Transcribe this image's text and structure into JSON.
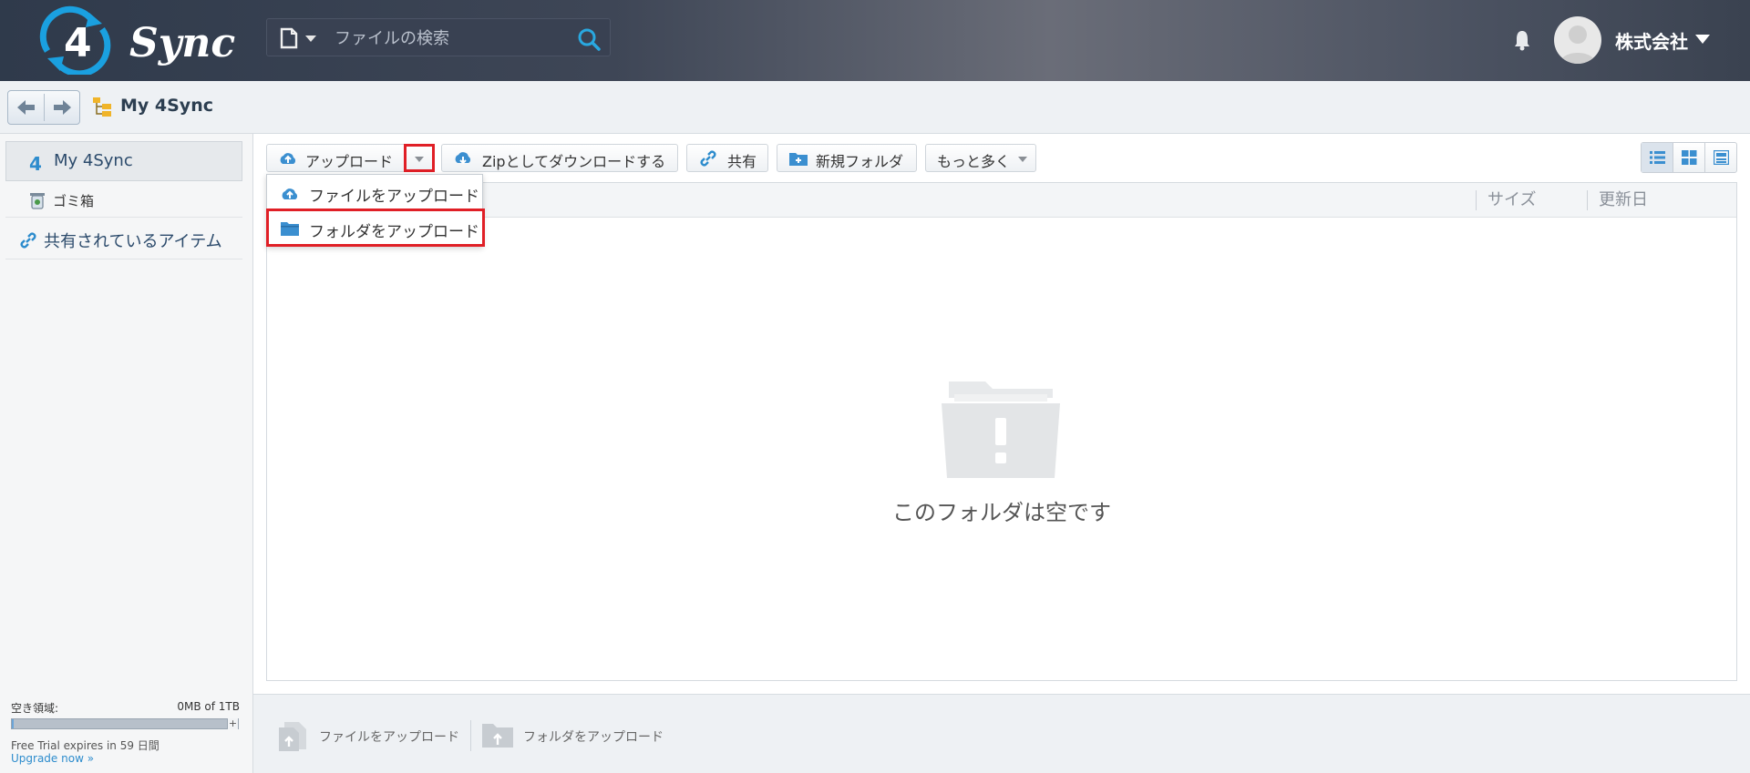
{
  "header": {
    "logo_text": "Sync",
    "logo_digit": "4",
    "search_placeholder": "ファイルの検索",
    "user_name": "株式会社"
  },
  "breadcrumb": {
    "current": "My 4Sync"
  },
  "sidebar": {
    "items": [
      {
        "label": "My 4Sync",
        "icon": "4sync-icon",
        "active": true
      },
      {
        "label": "ゴミ箱",
        "icon": "trash-icon"
      },
      {
        "label": "共有されているアイテム",
        "icon": "link-icon"
      }
    ],
    "storage": {
      "label": "空き領域:",
      "value": "0MB of 1TB",
      "fraction": 0.0,
      "trial": "Free Trial expires in 59 日間",
      "upgrade": "Upgrade now »"
    }
  },
  "toolbar": {
    "upload": "アップロード",
    "zip_download": "Zipとしてダウンロードする",
    "share": "共有",
    "new_folder": "新規フォルダ",
    "more": "もっと多く"
  },
  "upload_menu": {
    "items": [
      {
        "label": "ファイルをアップロード",
        "icon": "cloud-upload-icon"
      },
      {
        "label": "フォルダをアップロード",
        "icon": "folder-icon",
        "highlighted": true
      }
    ]
  },
  "file_list": {
    "columns": {
      "size": "サイズ",
      "date": "更新日"
    },
    "empty_message": "このフォルダは空です"
  },
  "bottom_bar": {
    "upload_file": "ファイルをアップロード",
    "upload_folder": "フォルダをアップロード"
  },
  "colors": {
    "accent": "#2d8ccd",
    "highlight": "#e01f26"
  }
}
